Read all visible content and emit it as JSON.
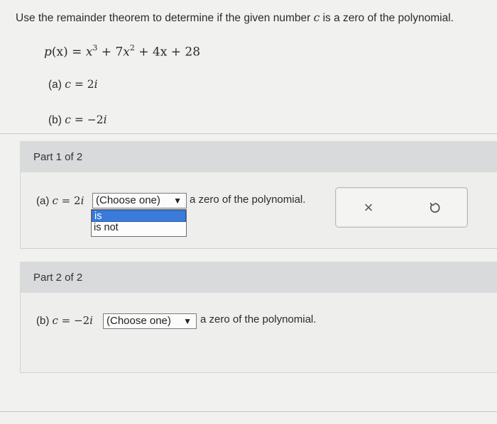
{
  "instruction": {
    "part1": "Use the remainder theorem to determine if the given number ",
    "var": "c",
    "part2": " is a zero of the polynomial."
  },
  "polynomial": {
    "lhs": "p",
    "arg": "(x)",
    "eq": " = ",
    "t1": "x",
    "t1_exp": "3",
    "plus1": " + 7",
    "t2": "x",
    "t2_exp": "2",
    "rest": " + 4x + 28"
  },
  "items": [
    {
      "label": "(a) ",
      "var": "c",
      "eq": " = ",
      "value": "2",
      "unit": "i"
    },
    {
      "label": "(b) ",
      "var": "c",
      "eq": " = ",
      "value": "−2",
      "unit": "i"
    }
  ],
  "parts": [
    {
      "header": "Part 1 of 2",
      "label": "(a) ",
      "var": "c",
      "eq": " = ",
      "value": "2",
      "unit": "i",
      "select_text": "(Choose one)",
      "suffix": "a zero of the polynomial.",
      "options": [
        "is",
        "is not"
      ]
    },
    {
      "header": "Part 2 of 2",
      "label": "(b) ",
      "var": "c",
      "eq": " = ",
      "value": "−2",
      "unit": "i",
      "select_text": "(Choose one)",
      "suffix": "a zero of the polynomial."
    }
  ],
  "icons": {
    "clear": "close-icon",
    "reset": "undo-icon",
    "dropdown": "triangle-down-icon"
  },
  "colors": {
    "selected_option": "#3a7ad9",
    "part_header_bg": "#d8dadb"
  }
}
